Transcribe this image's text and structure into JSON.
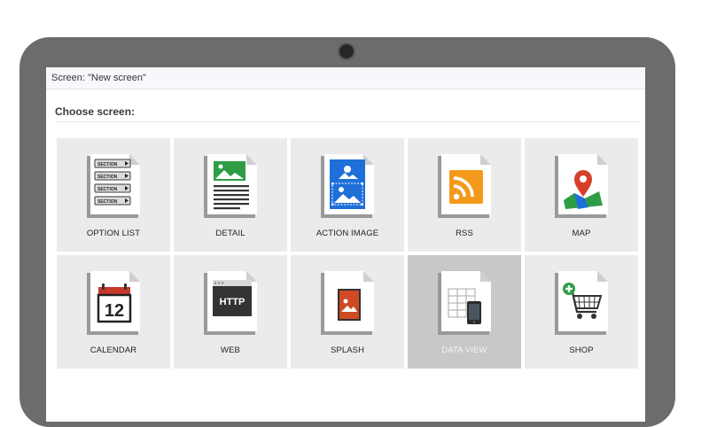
{
  "screen_header": {
    "title": "Screen: \"New screen\""
  },
  "section": {
    "title": "Choose screen:"
  },
  "tiles": [
    {
      "label": "OPTION LIST",
      "icon": "option-list-icon",
      "section_text": "SECTION"
    },
    {
      "label": "DETAIL",
      "icon": "detail-icon"
    },
    {
      "label": "ACTION IMAGE",
      "icon": "action-image-icon"
    },
    {
      "label": "RSS",
      "icon": "rss-icon"
    },
    {
      "label": "MAP",
      "icon": "map-icon"
    },
    {
      "label": "CALENDAR",
      "icon": "calendar-icon",
      "day": "12"
    },
    {
      "label": "WEB",
      "icon": "web-icon",
      "badge_text": "HTTP"
    },
    {
      "label": "SPLASH",
      "icon": "splash-icon"
    },
    {
      "label": "DATA VIEW",
      "icon": "data-view-icon",
      "selected": true
    },
    {
      "label": "SHOP",
      "icon": "shop-icon"
    }
  ],
  "colors": {
    "laptop_frame": "#6c6c6c",
    "tile_background": "#ebebeb",
    "selected_tile": "#c8c8c8",
    "green": "#2e9d45",
    "blue": "#1f6fd8",
    "rss_orange": "#f39a1c",
    "map_pin": "#d6402b",
    "calendar_red": "#c8392b",
    "splash_red": "#d04a24"
  }
}
